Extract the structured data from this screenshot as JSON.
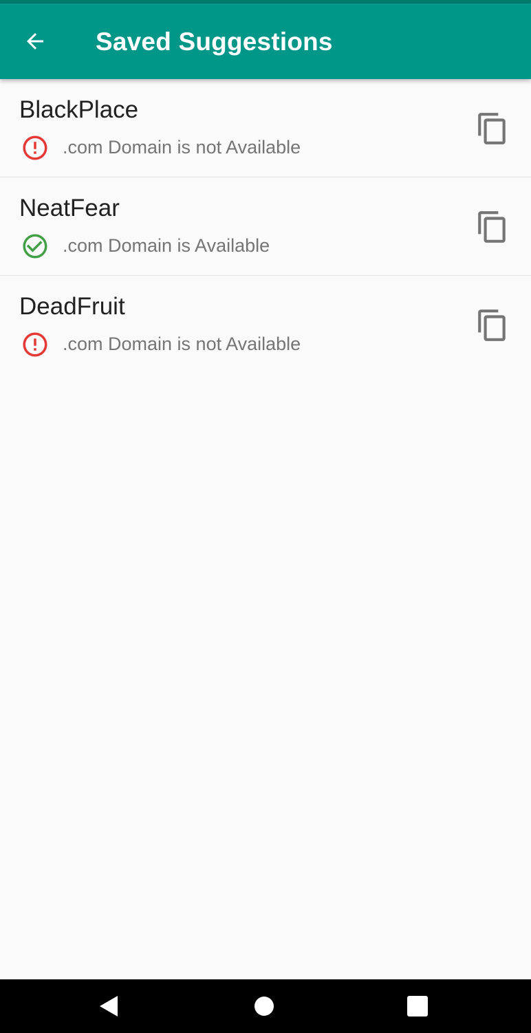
{
  "app_bar": {
    "title": "Saved Suggestions",
    "back_icon": "arrow-left-icon",
    "background": "#009688",
    "status_strip_color": "#00796b"
  },
  "suggestions": [
    {
      "name": "BlackPlace",
      "status_text": ".com Domain is not Available",
      "available": false,
      "status_icon": "error-circle-icon",
      "status_color": "#e53935",
      "action_icon": "copy-icon"
    },
    {
      "name": "NeatFear",
      "status_text": ".com Domain is Available",
      "available": true,
      "status_icon": "check-circle-icon",
      "status_color": "#43a047",
      "action_icon": "copy-icon"
    },
    {
      "name": "DeadFruit",
      "status_text": ".com Domain is not Available",
      "available": false,
      "status_icon": "error-circle-icon",
      "status_color": "#e53935",
      "action_icon": "copy-icon"
    }
  ],
  "nav_bar": {
    "back_icon": "nav-back-triangle-icon",
    "home_icon": "nav-home-circle-icon",
    "recents_icon": "nav-recents-square-icon"
  }
}
